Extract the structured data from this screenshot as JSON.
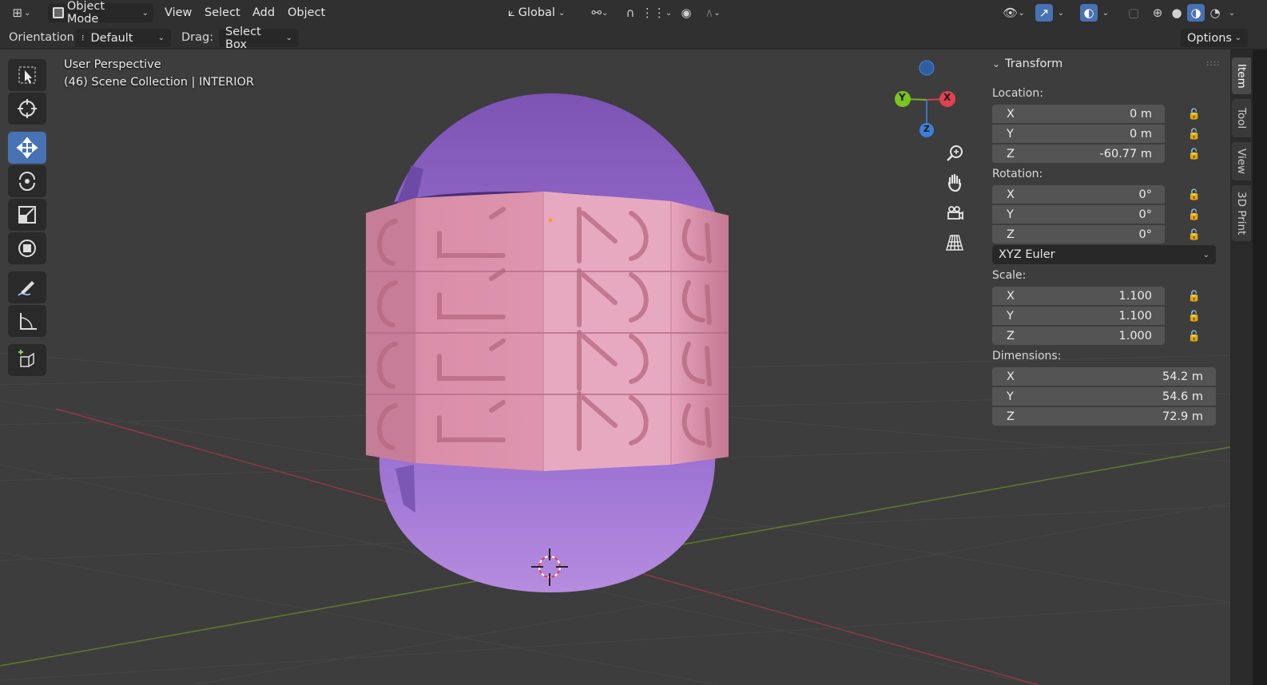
{
  "header": {
    "editor_type_icon": "axes-grid-icon",
    "mode_label": "Object Mode",
    "menus": [
      "View",
      "Select",
      "Add",
      "Object"
    ],
    "transform_orientation": "Global"
  },
  "tool_settings": {
    "orientation_label": "Orientation:",
    "orientation_value": "Default",
    "drag_label": "Drag:",
    "drag_value": "Select Box",
    "options_label": "Options"
  },
  "viewport": {
    "perspective_label": "User Perspective",
    "collection_label": "(46) Scene Collection | INTERIOR",
    "gizmo": {
      "x": "X",
      "y": "Y",
      "z": "Z"
    },
    "colors": {
      "x_axis": "#e8404a",
      "y_axis": "#7cc41f",
      "z_axis": "#3d7fd8",
      "band": "#d9899f",
      "dome": "#8a5fc0"
    }
  },
  "tools": [
    "select-box-icon",
    "cursor-icon",
    "move-icon",
    "rotate-icon",
    "scale-icon",
    "transform-icon",
    "annotate-icon",
    "measure-icon",
    "add-cube-icon"
  ],
  "npanel": {
    "title": "Transform",
    "location_label": "Location:",
    "location": {
      "x": "0 m",
      "y": "0 m",
      "z": "-60.77 m"
    },
    "rotation_label": "Rotation:",
    "rotation": {
      "x": "0°",
      "y": "0°",
      "z": "0°"
    },
    "rotation_mode": "XYZ Euler",
    "scale_label": "Scale:",
    "scale": {
      "x": "1.100",
      "y": "1.100",
      "z": "1.000"
    },
    "dimensions_label": "Dimensions:",
    "dimensions": {
      "x": "54.2 m",
      "y": "54.6 m",
      "z": "72.9 m"
    },
    "axis_x": "X",
    "axis_y": "Y",
    "axis_z": "Z"
  },
  "side_tabs": [
    "Item",
    "Tool",
    "View",
    "3D Print"
  ]
}
